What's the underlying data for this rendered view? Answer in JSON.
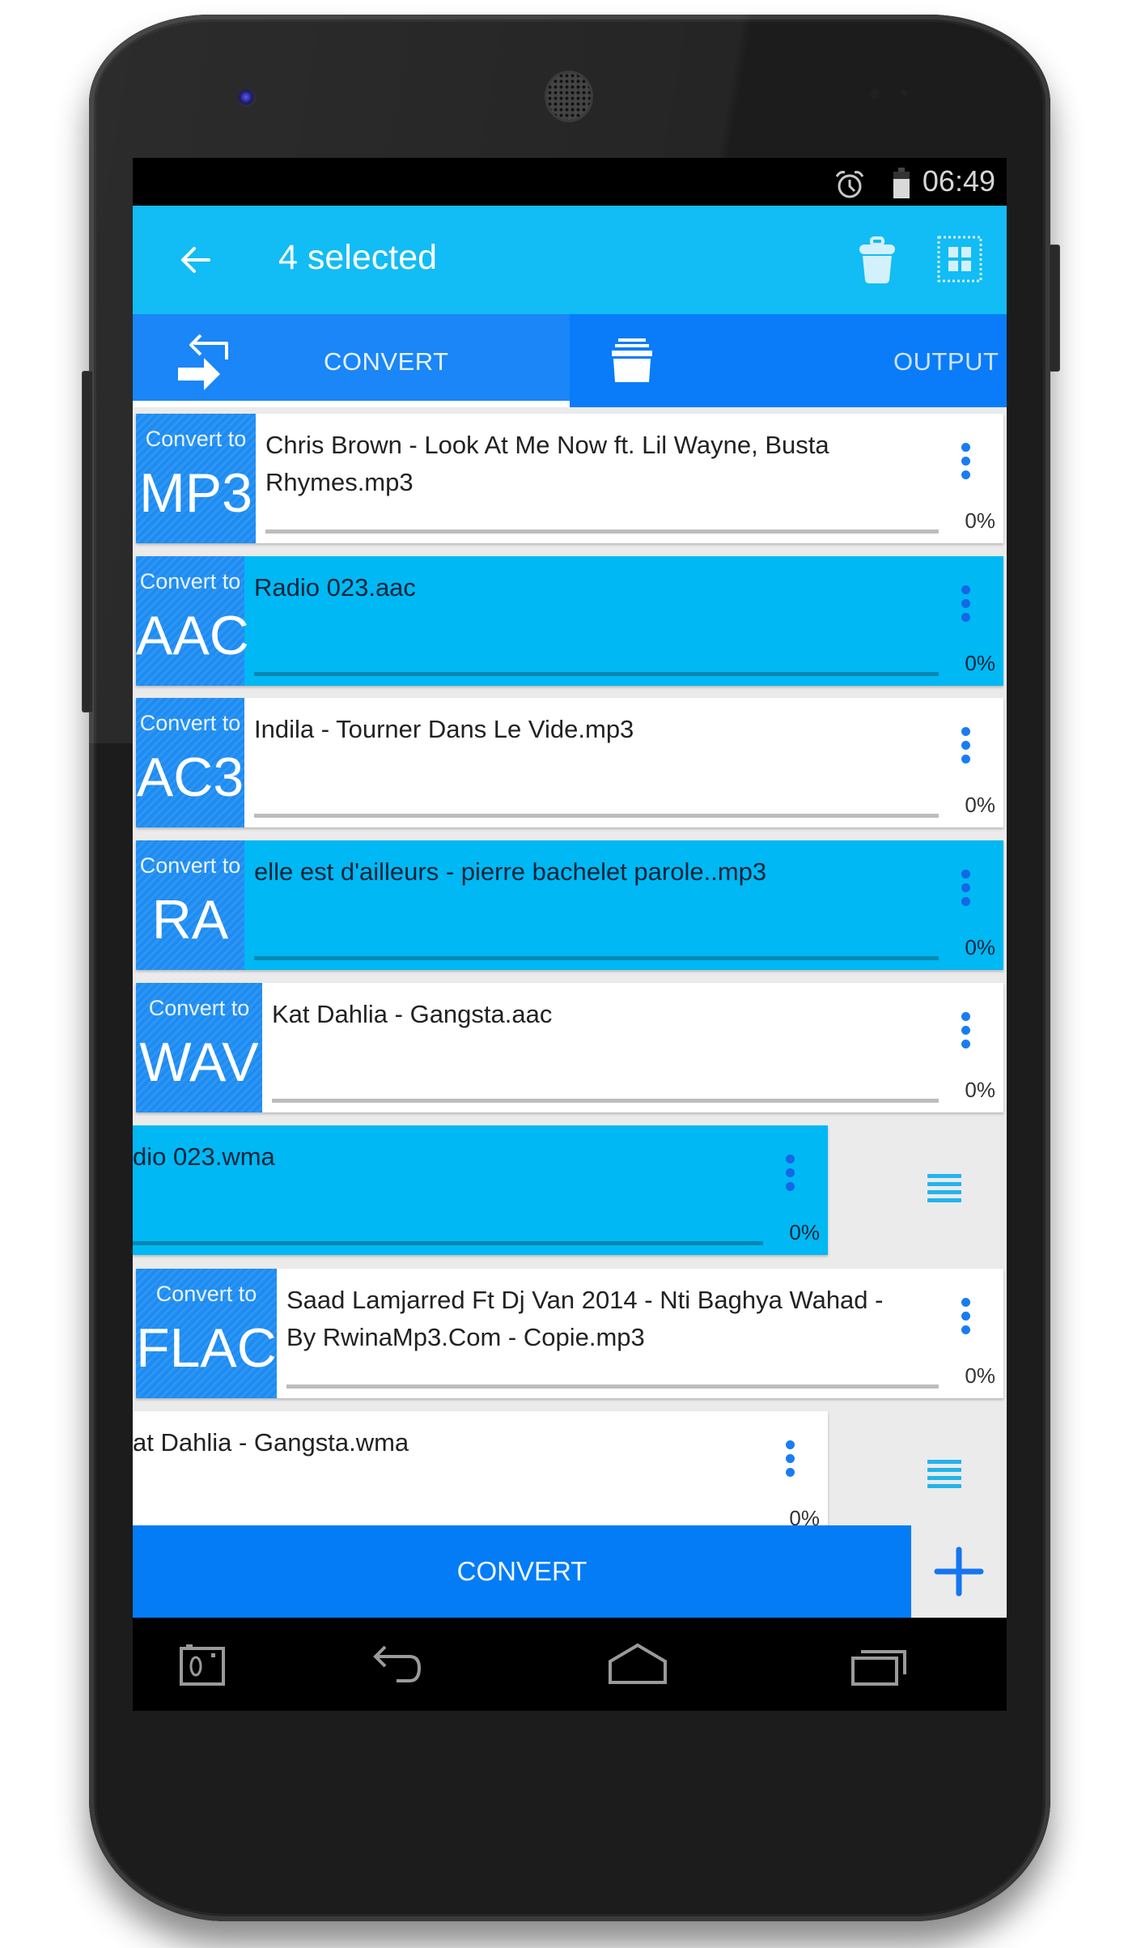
{
  "status_bar": {
    "time": "06:49",
    "icons": [
      "alarm-icon",
      "battery-icon"
    ]
  },
  "app_bar": {
    "back_icon": "arrow-left-icon",
    "title": "4 selected",
    "actions": [
      {
        "name": "delete",
        "icon": "trash-icon"
      },
      {
        "name": "select-all",
        "icon": "select-all-icon"
      }
    ]
  },
  "tabs": [
    {
      "label": "CONVERT",
      "icon": "convert-arrows-icon",
      "active": true
    },
    {
      "label": "OUTPUT",
      "icon": "output-folder-icon",
      "active": false
    }
  ],
  "list": {
    "items": [
      {
        "caption": "Convert to",
        "format": "MP3",
        "filename_lines": [
          "Chris Brown - Look At Me Now ft. Lil Wayne, Busta",
          "Rhymes.mp3"
        ],
        "progress_pct": 0,
        "progress_label": "0%",
        "selected": false,
        "swiped": false
      },
      {
        "caption": "Convert to",
        "format": "AAC",
        "filename_lines": [
          "Radio 023.aac"
        ],
        "progress_pct": 0,
        "progress_label": "0%",
        "selected": true,
        "swiped": false
      },
      {
        "caption": "Convert to",
        "format": "AC3",
        "filename_lines": [
          "Indila - Tourner Dans Le Vide.mp3"
        ],
        "progress_pct": 0,
        "progress_label": "0%",
        "selected": false,
        "swiped": false
      },
      {
        "caption": "Convert to",
        "format": "RA",
        "filename_lines": [
          "elle est d'ailleurs - pierre bachelet parole..mp3"
        ],
        "progress_pct": 0,
        "progress_label": "0%",
        "selected": true,
        "swiped": false
      },
      {
        "caption": "Convert to",
        "format": "WAV",
        "filename_lines": [
          "Kat Dahlia - Gangsta.aac"
        ],
        "progress_pct": 0,
        "progress_label": "0%",
        "selected": false,
        "swiped": false
      },
      {
        "caption": "",
        "format": "",
        "filename_lines": [
          "dio 023.wma"
        ],
        "progress_pct": 0,
        "progress_label": "0%",
        "selected": true,
        "swiped": true
      },
      {
        "caption": "Convert to",
        "format": "FLAC",
        "filename_lines": [
          "Saad Lamjarred Ft Dj Van 2014 - Nti Baghya Wahad -",
          "By RwinaMp3.Com - Copie.mp3"
        ],
        "progress_pct": 0,
        "progress_label": "0%",
        "selected": false,
        "swiped": false
      },
      {
        "caption": "",
        "format": "",
        "filename_lines": [
          "at Dahlia - Gangsta.wma"
        ],
        "progress_pct": 0,
        "progress_label": "0%",
        "selected": false,
        "swiped": true
      }
    ]
  },
  "bottom_bar": {
    "convert_label": "CONVERT",
    "add_icon": "plus-icon"
  },
  "nav_bar": {
    "buttons": [
      "screenshot-icon",
      "back-icon",
      "home-icon",
      "recents-icon"
    ]
  },
  "colors": {
    "app_bar": "#12bcf5",
    "tab_bar": "#0a80fb",
    "accent_blue": "#037cf6",
    "selected_row": "#00b8f3",
    "badge": "#1d8cf2"
  }
}
